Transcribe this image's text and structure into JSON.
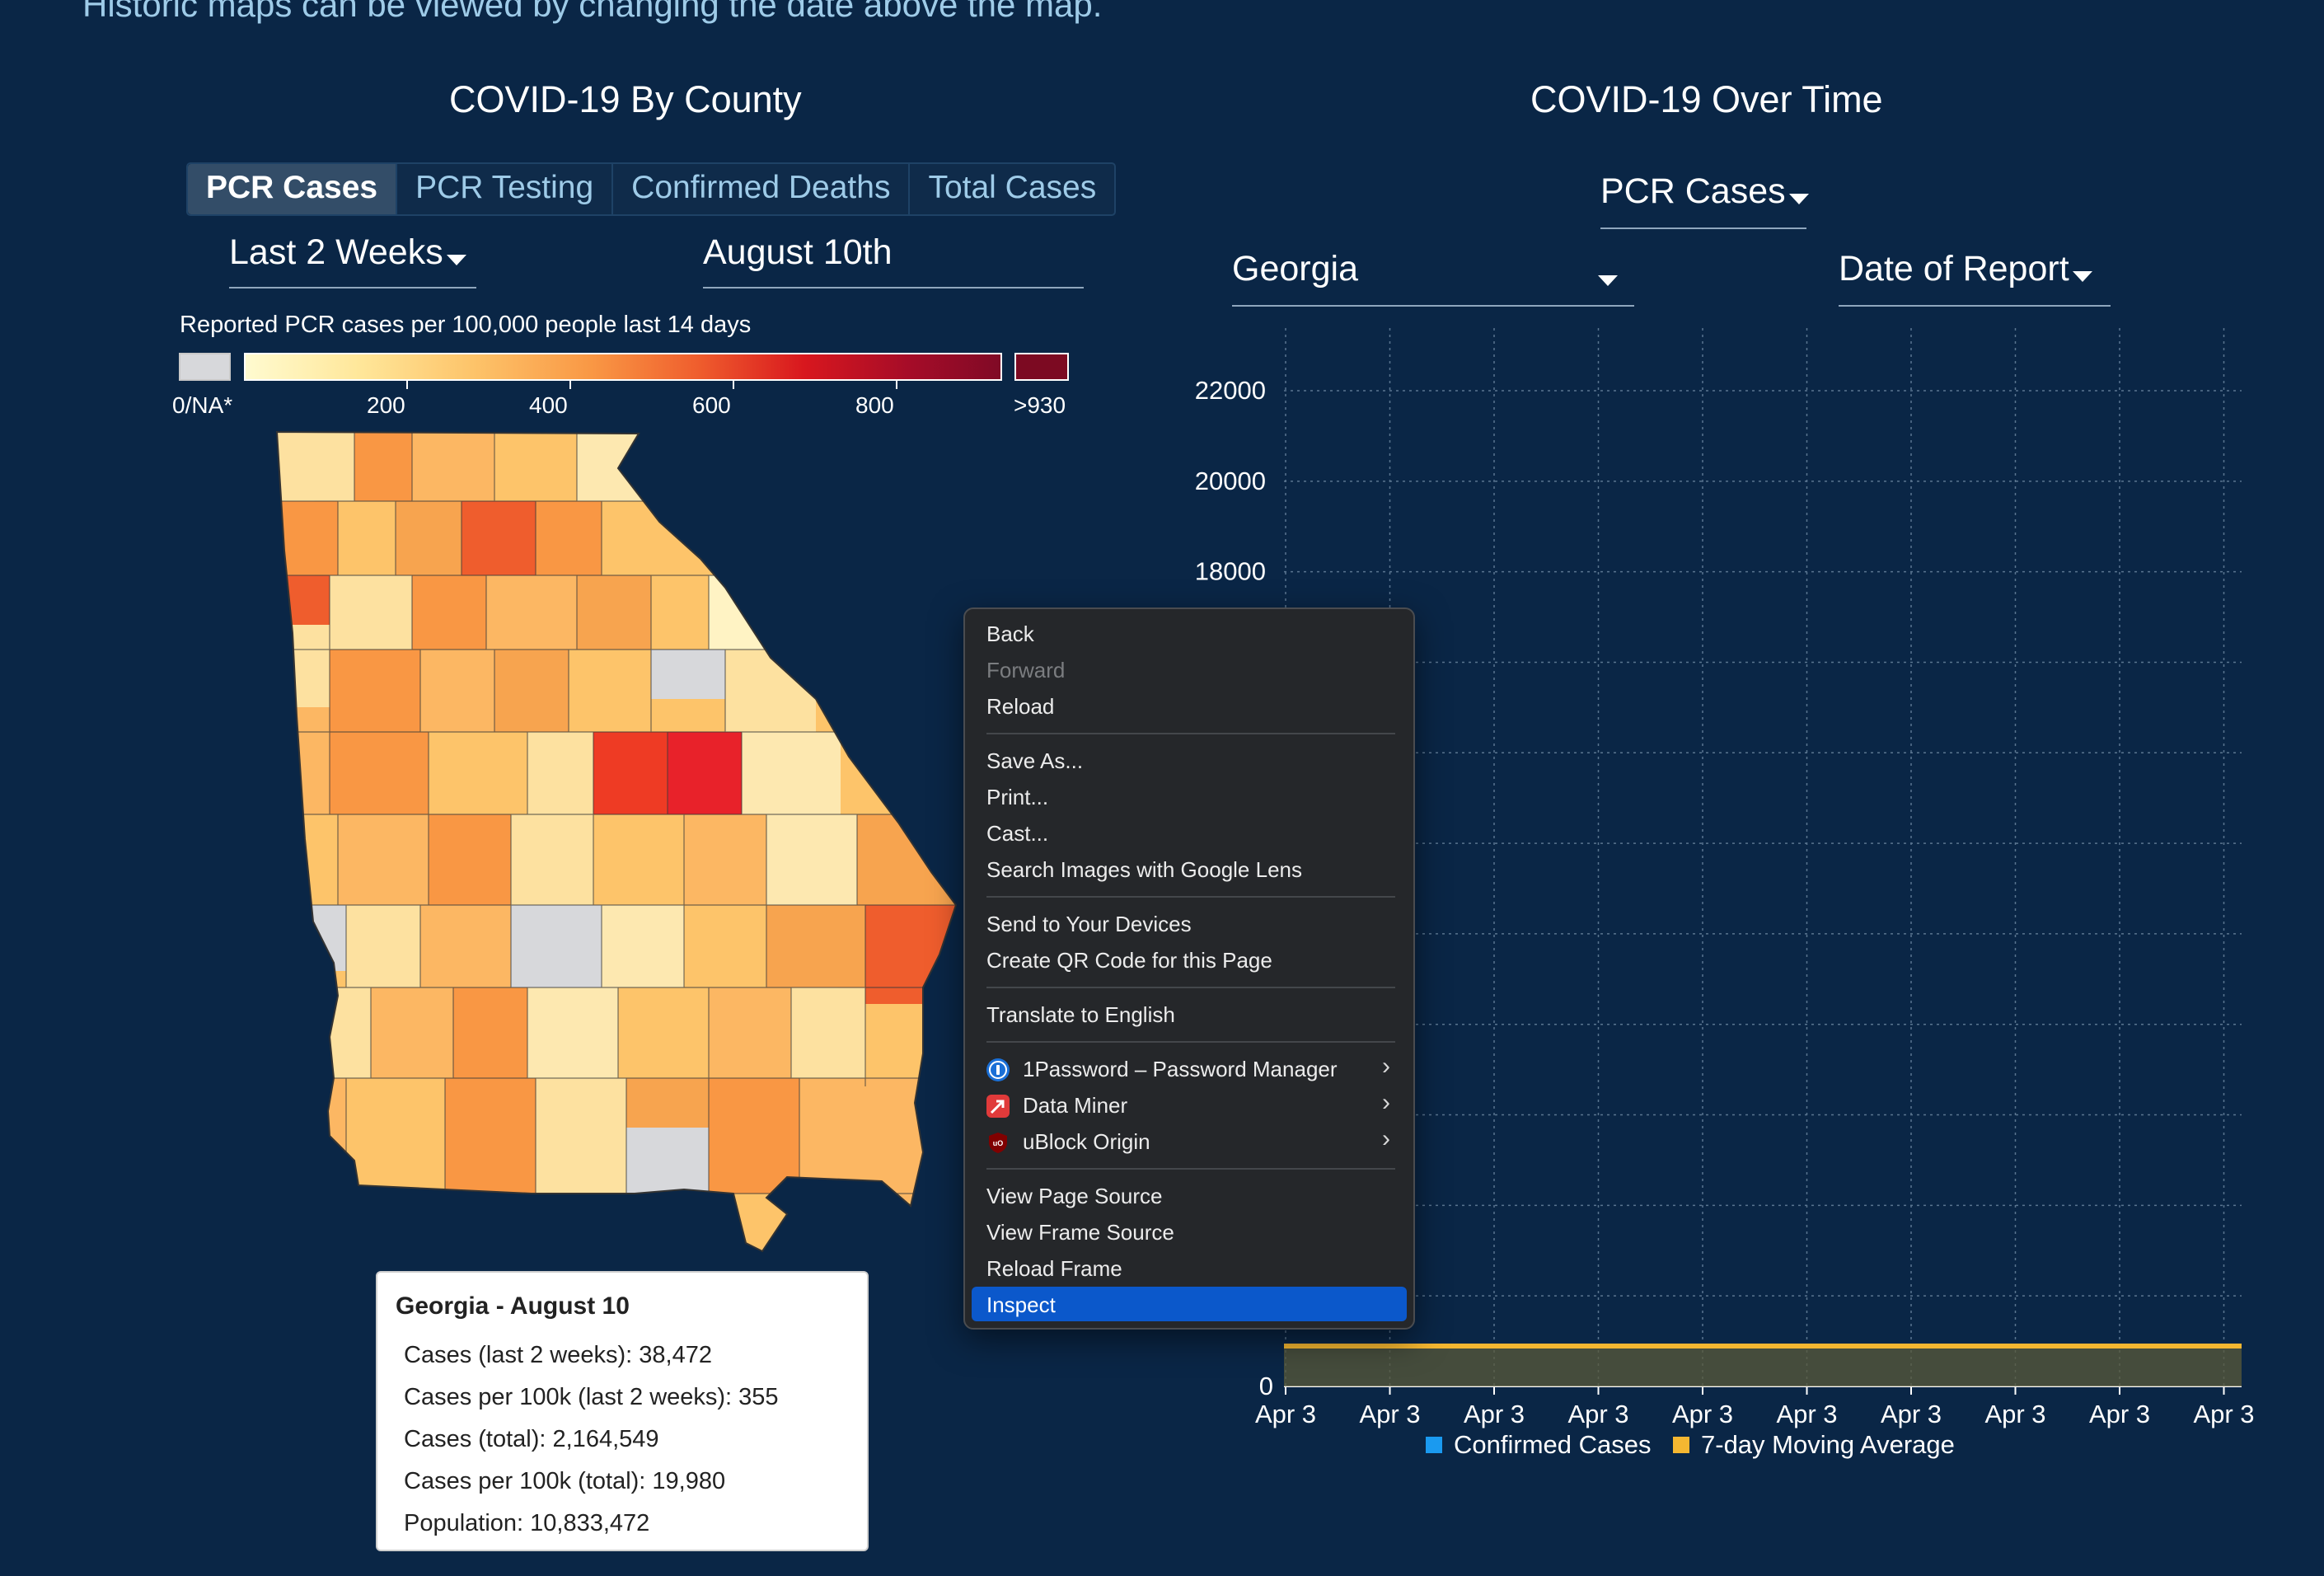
{
  "intro_text": "Historic maps can be viewed by changing the date above the map.",
  "county_section": {
    "title": "COVID-19 By County",
    "tabs": [
      {
        "label": "PCR Cases",
        "active": true
      },
      {
        "label": "PCR Testing",
        "active": false
      },
      {
        "label": "Confirmed Deaths",
        "active": false
      },
      {
        "label": "Total Cases",
        "active": false
      }
    ],
    "period_select": "Last 2 Weeks",
    "date_field": "August 10th",
    "legend": {
      "title": "Reported PCR cases per 100,000 people last 14 days",
      "na_label": "0/NA*",
      "ticks": [
        "200",
        "400",
        "600",
        "800"
      ],
      "max_label": ">930"
    },
    "tooltip": {
      "title": "Georgia - August 10",
      "lines": [
        "Cases (last 2 weeks): 38,472",
        "Cases per 100k (last 2 weeks): 355",
        "Cases (total): 2,164,549",
        "Cases per 100k (total): 19,980",
        "Population: 10,833,472"
      ]
    }
  },
  "time_section": {
    "title": "COVID-19 Over Time",
    "metric_select": "PCR Cases",
    "region_select": "Georgia",
    "date_type_select": "Date of Report"
  },
  "chart_data": {
    "type": "area",
    "y_tick_labels": [
      "0",
      "18000",
      "20000",
      "22000"
    ],
    "x_tick_labels": [
      "Apr 3",
      "Apr 3",
      "Apr 3",
      "Apr 3",
      "Apr 3",
      "Apr 3",
      "Apr 3",
      "Apr 3",
      "Apr 3",
      "Apr 3"
    ],
    "series": [
      {
        "name": "Confirmed Cases",
        "color": "#1a9af0"
      },
      {
        "name": "7-day Moving Average",
        "color": "#f5b731"
      }
    ],
    "grid": true
  },
  "context_menu": {
    "items": [
      {
        "label": "Back",
        "disabled": false
      },
      {
        "label": "Forward",
        "disabled": true
      },
      {
        "label": "Reload",
        "disabled": false
      },
      {
        "label": "Save As...",
        "disabled": false
      },
      {
        "label": "Print...",
        "disabled": false
      },
      {
        "label": "Cast...",
        "disabled": false
      },
      {
        "label": "Search Images with Google Lens",
        "disabled": false
      },
      {
        "label": "Send to Your Devices",
        "disabled": false
      },
      {
        "label": "Create QR Code for this Page",
        "disabled": false
      },
      {
        "label": "Translate to English",
        "disabled": false
      },
      {
        "label": "1Password – Password Manager",
        "icon": "1password-icon"
      },
      {
        "label": "Data Miner",
        "icon": "data-miner-icon"
      },
      {
        "label": "uBlock Origin",
        "icon": "ublock-origin-icon"
      },
      {
        "label": "View Page Source",
        "disabled": false
      },
      {
        "label": "View Frame Source",
        "disabled": false
      },
      {
        "label": "Reload Frame",
        "disabled": false
      },
      {
        "label": "Inspect",
        "highlighted": true
      }
    ]
  },
  "colors": {
    "background": "#0a2646",
    "accent_link": "#9ecbe8",
    "menu_highlight": "#0b58cb"
  }
}
